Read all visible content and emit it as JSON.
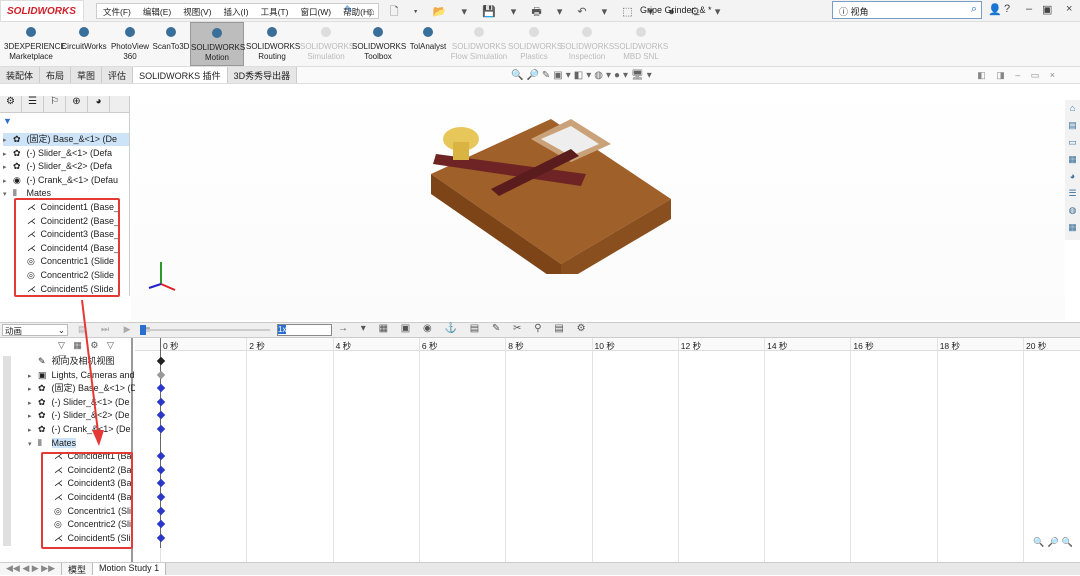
{
  "app": {
    "logo": "SOLIDWORKS",
    "title": "Gripe Grinder_& *",
    "search_placeholder": "视角",
    "menu": [
      "文件(F)",
      "编辑(E)",
      "视图(V)",
      "插入(I)",
      "工具(T)",
      "窗口(W)",
      "帮助(H)"
    ]
  },
  "ribbon": [
    {
      "l1": "3DEXPERIENCE",
      "l2": "Marketplace",
      "state": "normal"
    },
    {
      "l1": "CircuitWorks",
      "l2": "",
      "state": "normal"
    },
    {
      "l1": "PhotoView",
      "l2": "360",
      "state": "normal"
    },
    {
      "l1": "ScanTo3D",
      "l2": "",
      "state": "normal"
    },
    {
      "l1": "SOLIDWORKS",
      "l2": "Motion",
      "state": "selected"
    },
    {
      "l1": "SOLIDWORKS",
      "l2": "Routing",
      "state": "normal"
    },
    {
      "l1": "SOLIDWORKS",
      "l2": "Simulation",
      "state": "disabled"
    },
    {
      "l1": "SOLIDWORKS",
      "l2": "Toolbox",
      "state": "normal"
    },
    {
      "l1": "TolAnalyst",
      "l2": "",
      "state": "normal"
    },
    {
      "l1": "SOLIDWORKS",
      "l2": "Flow Simulation",
      "state": "disabled"
    },
    {
      "l1": "SOLIDWORKS",
      "l2": "Plastics",
      "state": "disabled"
    },
    {
      "l1": "SOLIDWORKS",
      "l2": "Inspection",
      "state": "disabled"
    },
    {
      "l1": "SOLIDWORKS",
      "l2": "MBD SNL",
      "state": "disabled"
    }
  ],
  "tabs": [
    "装配体",
    "布局",
    "草图",
    "评估",
    "SOLIDWORKS 插件",
    "3D秀秀导出器"
  ],
  "feature_tree": {
    "components": [
      "(固定) Base_&<1> (De",
      "(-) Slider_&<1> (Defa",
      "(-) Slider_&<2> (Defa",
      "(-) Crank_&<1> (Defau"
    ],
    "mates_label": "Mates",
    "mates": [
      "Coincident1 (Base_",
      "Coincident2 (Base_",
      "Coincident3 (Base_",
      "Coincident4 (Base_",
      "Concentric1 (Slide",
      "Concentric2 (Slide",
      "Coincident5 (Slide"
    ]
  },
  "motion": {
    "study_type": "动画",
    "speed": "1x",
    "tree_top": [
      "视向及相机视图",
      "Lights, Cameras and",
      "(固定) Base_&<1> (De",
      "(-) Slider_&<1> (De",
      "(-) Slider_&<2> (De",
      "(-) Crank_&<1> (De"
    ],
    "mates_label": "Mates",
    "mates": [
      "Coincident1 (Ba",
      "Coincident2 (Ba",
      "Coincident3 (Ba",
      "Coincident4 (Ba",
      "Concentric1 (Sli",
      "Concentric2 (Sli",
      "Coincident5 (Sli"
    ],
    "time_ticks": [
      "0 秒",
      "2 秒",
      "4 秒",
      "6 秒",
      "8 秒",
      "10 秒",
      "12 秒",
      "14 秒",
      "16 秒",
      "18 秒",
      "20 秒"
    ]
  },
  "bottom_tabs": [
    "模型",
    "Motion Study 1"
  ],
  "colors": {
    "highlight_box": "#e53935",
    "keyframe": "#2b37c8",
    "part_wood": "#a0602a",
    "part_crank": "#6e2424",
    "knob": "#e8c75a"
  }
}
